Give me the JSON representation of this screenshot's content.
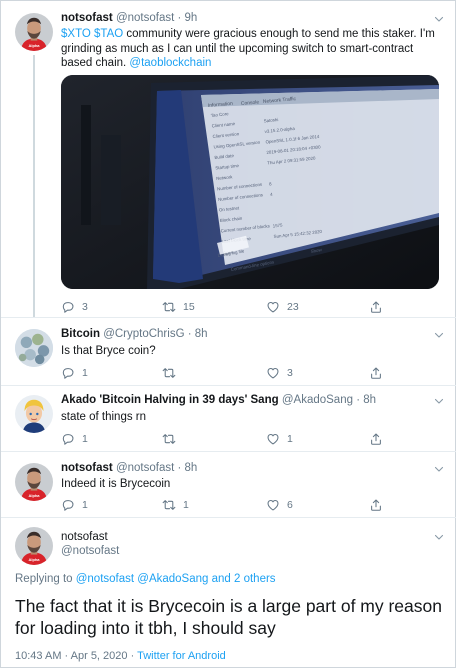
{
  "tweets": [
    {
      "name": "notsofast",
      "handle": "@notsofast",
      "time": "· 9h",
      "text_pre": " community were gracious enough to send me this staker. I'm grinding as much as I can until the upcoming switch to smart-contract based chain. ",
      "cashtags": "$XTO $TAO",
      "mention": "@taoblockchain",
      "replies": "3",
      "retweets": "15",
      "likes": "23",
      "photo": {
        "tabs": [
          "Information",
          "Console",
          "Network Traffic"
        ],
        "rows": [
          [
            "Tao Core",
            ""
          ],
          [
            "Client name",
            "Satoshi"
          ],
          [
            "Client version",
            "v3.15.2.0-alpha"
          ],
          [
            "Using OpenSSL version",
            "OpenSSL 1.0.1f 6 Jan 2014"
          ],
          [
            "Build date",
            "2019-08-01 20:18:04 +0300"
          ],
          [
            "Startup time",
            "Thu Apr 2 09:31:59 2020"
          ],
          [
            "Network",
            ""
          ],
          [
            "Number of connections",
            "8"
          ],
          [
            "Number of connections",
            "4"
          ],
          [
            "On testnet",
            ""
          ],
          [
            "Block chain",
            ""
          ],
          [
            "Current number of blocks",
            "1575"
          ],
          [
            "Last block time",
            "Sun Apr 5 15:42:32 2020"
          ]
        ],
        "section": "Debug log file",
        "open_button": "Open",
        "command_line": "Command-line options",
        "show_button": "Show"
      }
    },
    {
      "name": "Bitcoin",
      "handle": "@CryptoChrisG",
      "time": "· 8h",
      "text": "Is that Bryce coin?",
      "replies": "1",
      "retweets": "",
      "likes": "3"
    },
    {
      "name": "Akado 'Bitcoin Halving in 39 days' Sang",
      "handle": "@AkadoSang",
      "time": "· 8h",
      "text": "state of things rn",
      "replies": "1",
      "retweets": "",
      "likes": "1"
    },
    {
      "name": "notsofast",
      "handle": "@notsofast",
      "time": "· 8h",
      "text": "Indeed it is Brycecoin",
      "replies": "1",
      "retweets": "1",
      "likes": "6"
    }
  ],
  "main_tweet": {
    "name": "notsofast",
    "handle": "@notsofast",
    "replying_prefix": "Replying to ",
    "replying_to": "@notsofast @AkadoSang and 2 others",
    "text": "The fact that it is Brycecoin is a large part of my reason for loading into it tbh, I should say",
    "timestamp": "10:43 AM · Apr 5, 2020 · ",
    "source": "Twitter for Android"
  },
  "colors": {
    "accent": "#1da1f2",
    "secondary_text": "#657786",
    "avatar_shirt": "#d8232a"
  },
  "icons": [
    "chevron-down-icon",
    "reply-icon",
    "retweet-icon",
    "like-icon",
    "share-icon"
  ]
}
